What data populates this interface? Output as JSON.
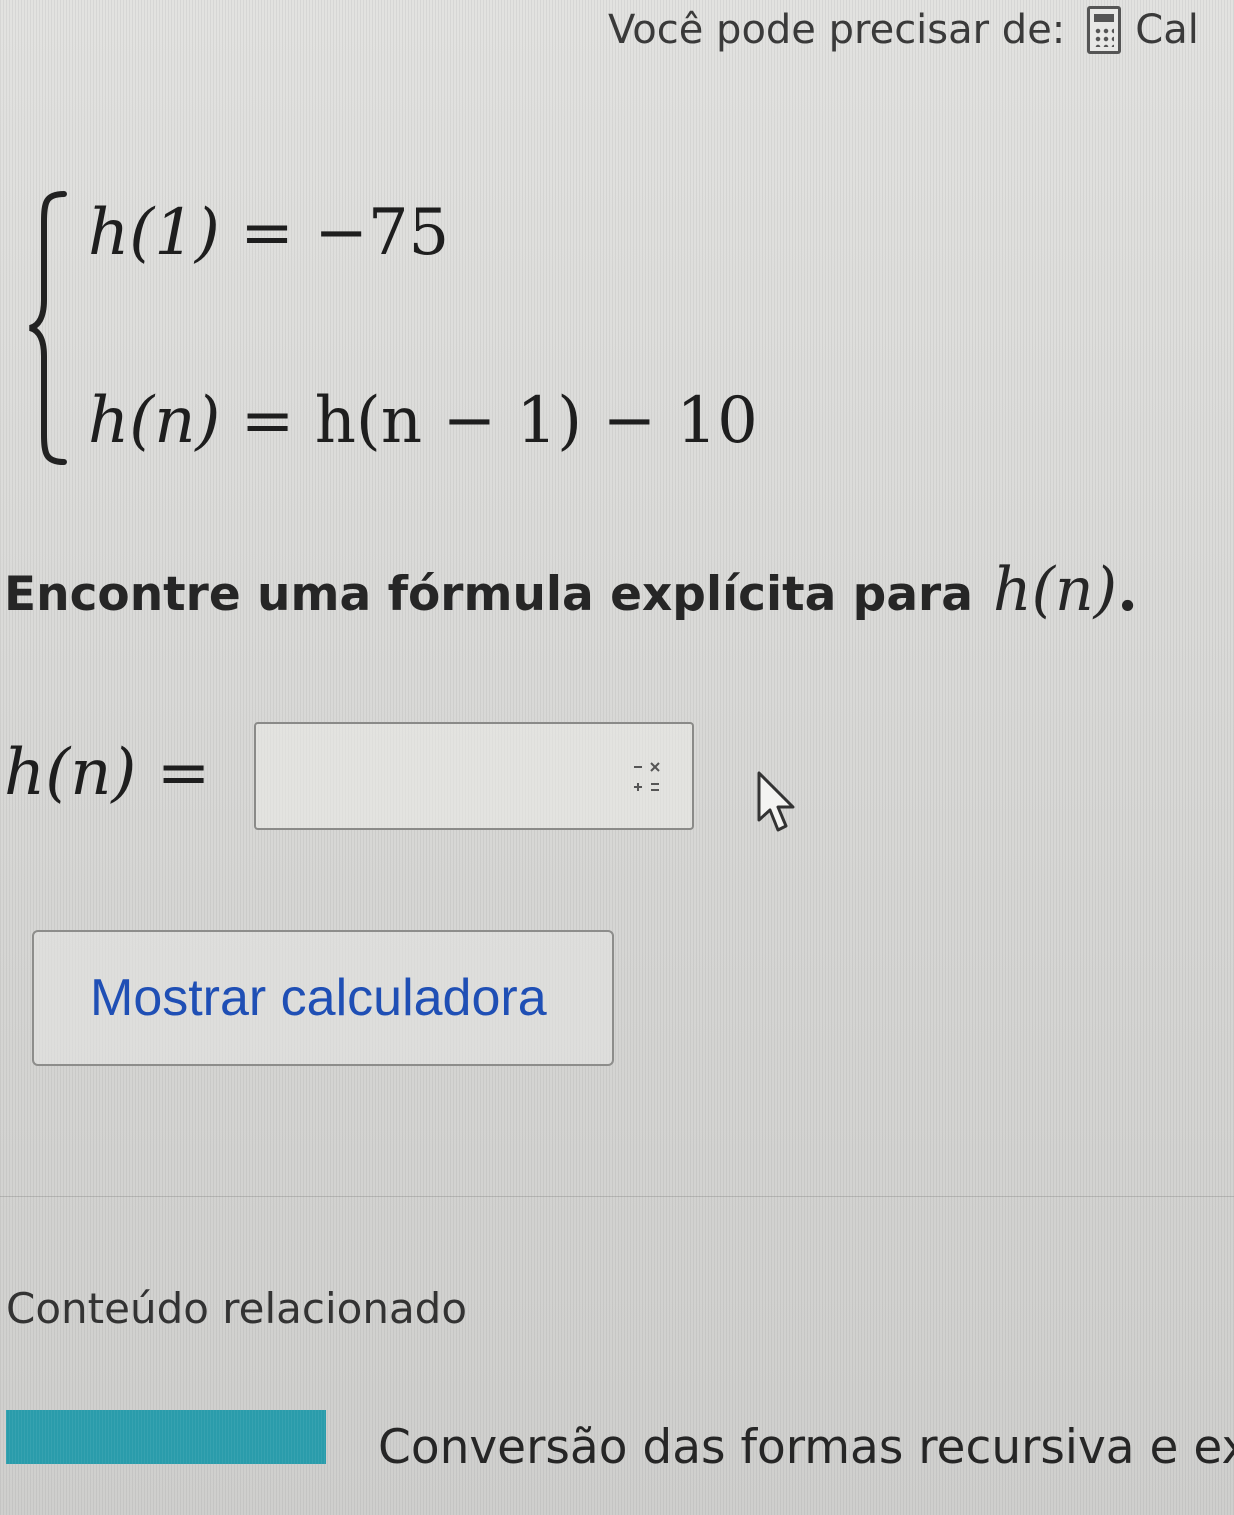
{
  "header": {
    "need_label": "Você pode precisar de:",
    "calculator_label": "Cal"
  },
  "problem": {
    "line1": {
      "lhs": "h(1)",
      "rhs": "= −75"
    },
    "line2": {
      "lhs": "h(n)",
      "rhs": "= h(n − 1) − 10"
    },
    "question_text": "Encontre uma fórmula explícita para",
    "question_math": "h(n)",
    "question_end": "."
  },
  "answer": {
    "lhs": "h(n) =",
    "value": "",
    "placeholder": ""
  },
  "calc_button": {
    "label": "Mostrar calculadora"
  },
  "related": {
    "title": "Conteúdo relacionado",
    "item_title": "Conversão das formas recursiva e expli",
    "thumb_color": "#2a9cab"
  },
  "colors": {
    "link_blue": "#1f4fb5",
    "background": "#dcdcda"
  },
  "icons": {
    "calculator": "calculator-icon",
    "math_keyboard": "math-keyboard-icon",
    "cursor": "mouse-pointer-icon"
  }
}
